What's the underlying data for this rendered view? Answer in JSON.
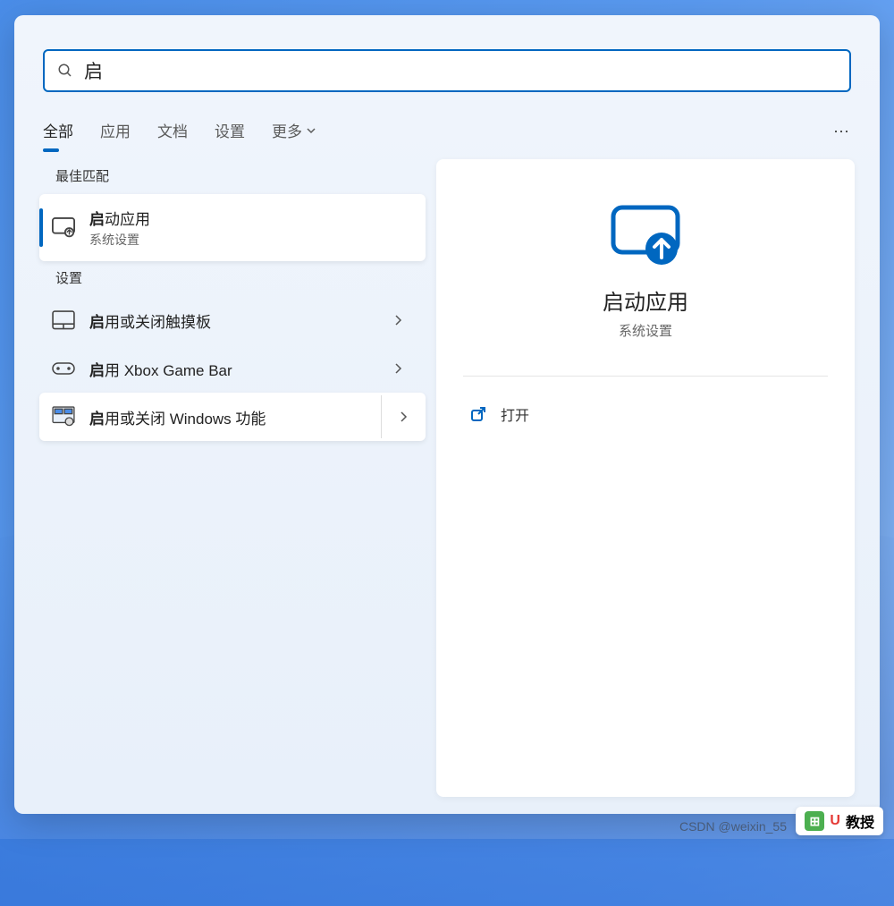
{
  "search": {
    "query": "启"
  },
  "tabs": {
    "items": [
      "全部",
      "应用",
      "文档",
      "设置",
      "更多"
    ],
    "active_index": 0
  },
  "sections": {
    "best_match": "最佳匹配",
    "settings": "设置"
  },
  "results": {
    "best": {
      "title_bold": "启",
      "title_rest": "动应用",
      "subtitle": "系统设置"
    },
    "settings_items": [
      {
        "bold": "启",
        "rest": "用或关闭触摸板"
      },
      {
        "bold": "启",
        "rest": "用 Xbox Game Bar"
      },
      {
        "bold": "启",
        "rest": "用或关闭 Windows 功能"
      }
    ]
  },
  "preview": {
    "title": "启动应用",
    "subtitle": "系统设置",
    "actions": {
      "open": "打开"
    }
  },
  "watermark": "CSDN @weixin_55",
  "logo": {
    "text": "教授",
    "prefix": "U"
  }
}
